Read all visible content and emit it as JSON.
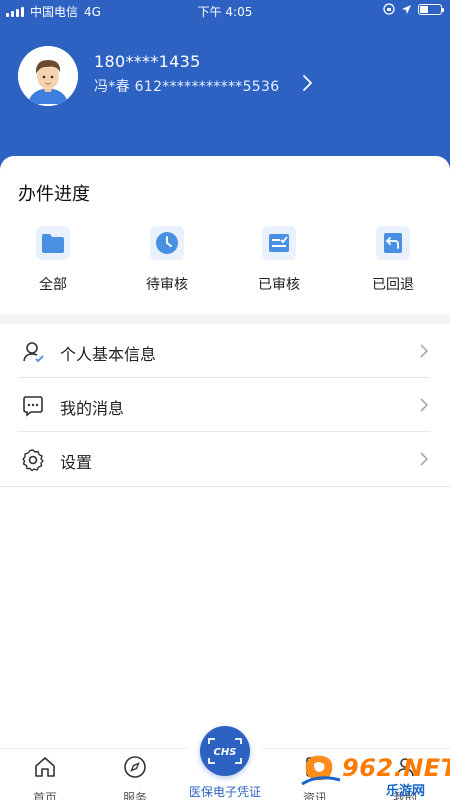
{
  "status_bar": {
    "carrier": "中国电信",
    "network": "4G",
    "time": "下午 4:05"
  },
  "profile": {
    "phone": "180****1435",
    "id_line": "冯*春  612***********5536"
  },
  "progress": {
    "title": "办件进度",
    "items": [
      {
        "label": "全部",
        "icon": "folder-icon"
      },
      {
        "label": "待审核",
        "icon": "clock-icon"
      },
      {
        "label": "已审核",
        "icon": "approved-list-icon"
      },
      {
        "label": "已回退",
        "icon": "return-arrow-icon"
      }
    ]
  },
  "menu": {
    "items": [
      {
        "label": "个人基本信息",
        "icon": "user-check-icon"
      },
      {
        "label": "我的消息",
        "icon": "message-icon"
      },
      {
        "label": "设置",
        "icon": "gear-icon"
      }
    ]
  },
  "tabbar": {
    "items": [
      {
        "label": "首页",
        "icon": "home-icon"
      },
      {
        "label": "服务",
        "icon": "compass-icon"
      },
      {
        "label": "资讯",
        "icon": "news-icon"
      },
      {
        "label": "我的",
        "icon": "profile-icon"
      }
    ],
    "center_label": "医保电子凭证",
    "center_logo_text": "CHS"
  },
  "watermark": {
    "brand": "962.NET",
    "sub": "乐游网"
  },
  "colors": {
    "primary": "#2d62c2",
    "icon_bg": "#e9f1fd",
    "icon_accent": "#4a90e2",
    "watermark_orange": "#ff7a00"
  }
}
